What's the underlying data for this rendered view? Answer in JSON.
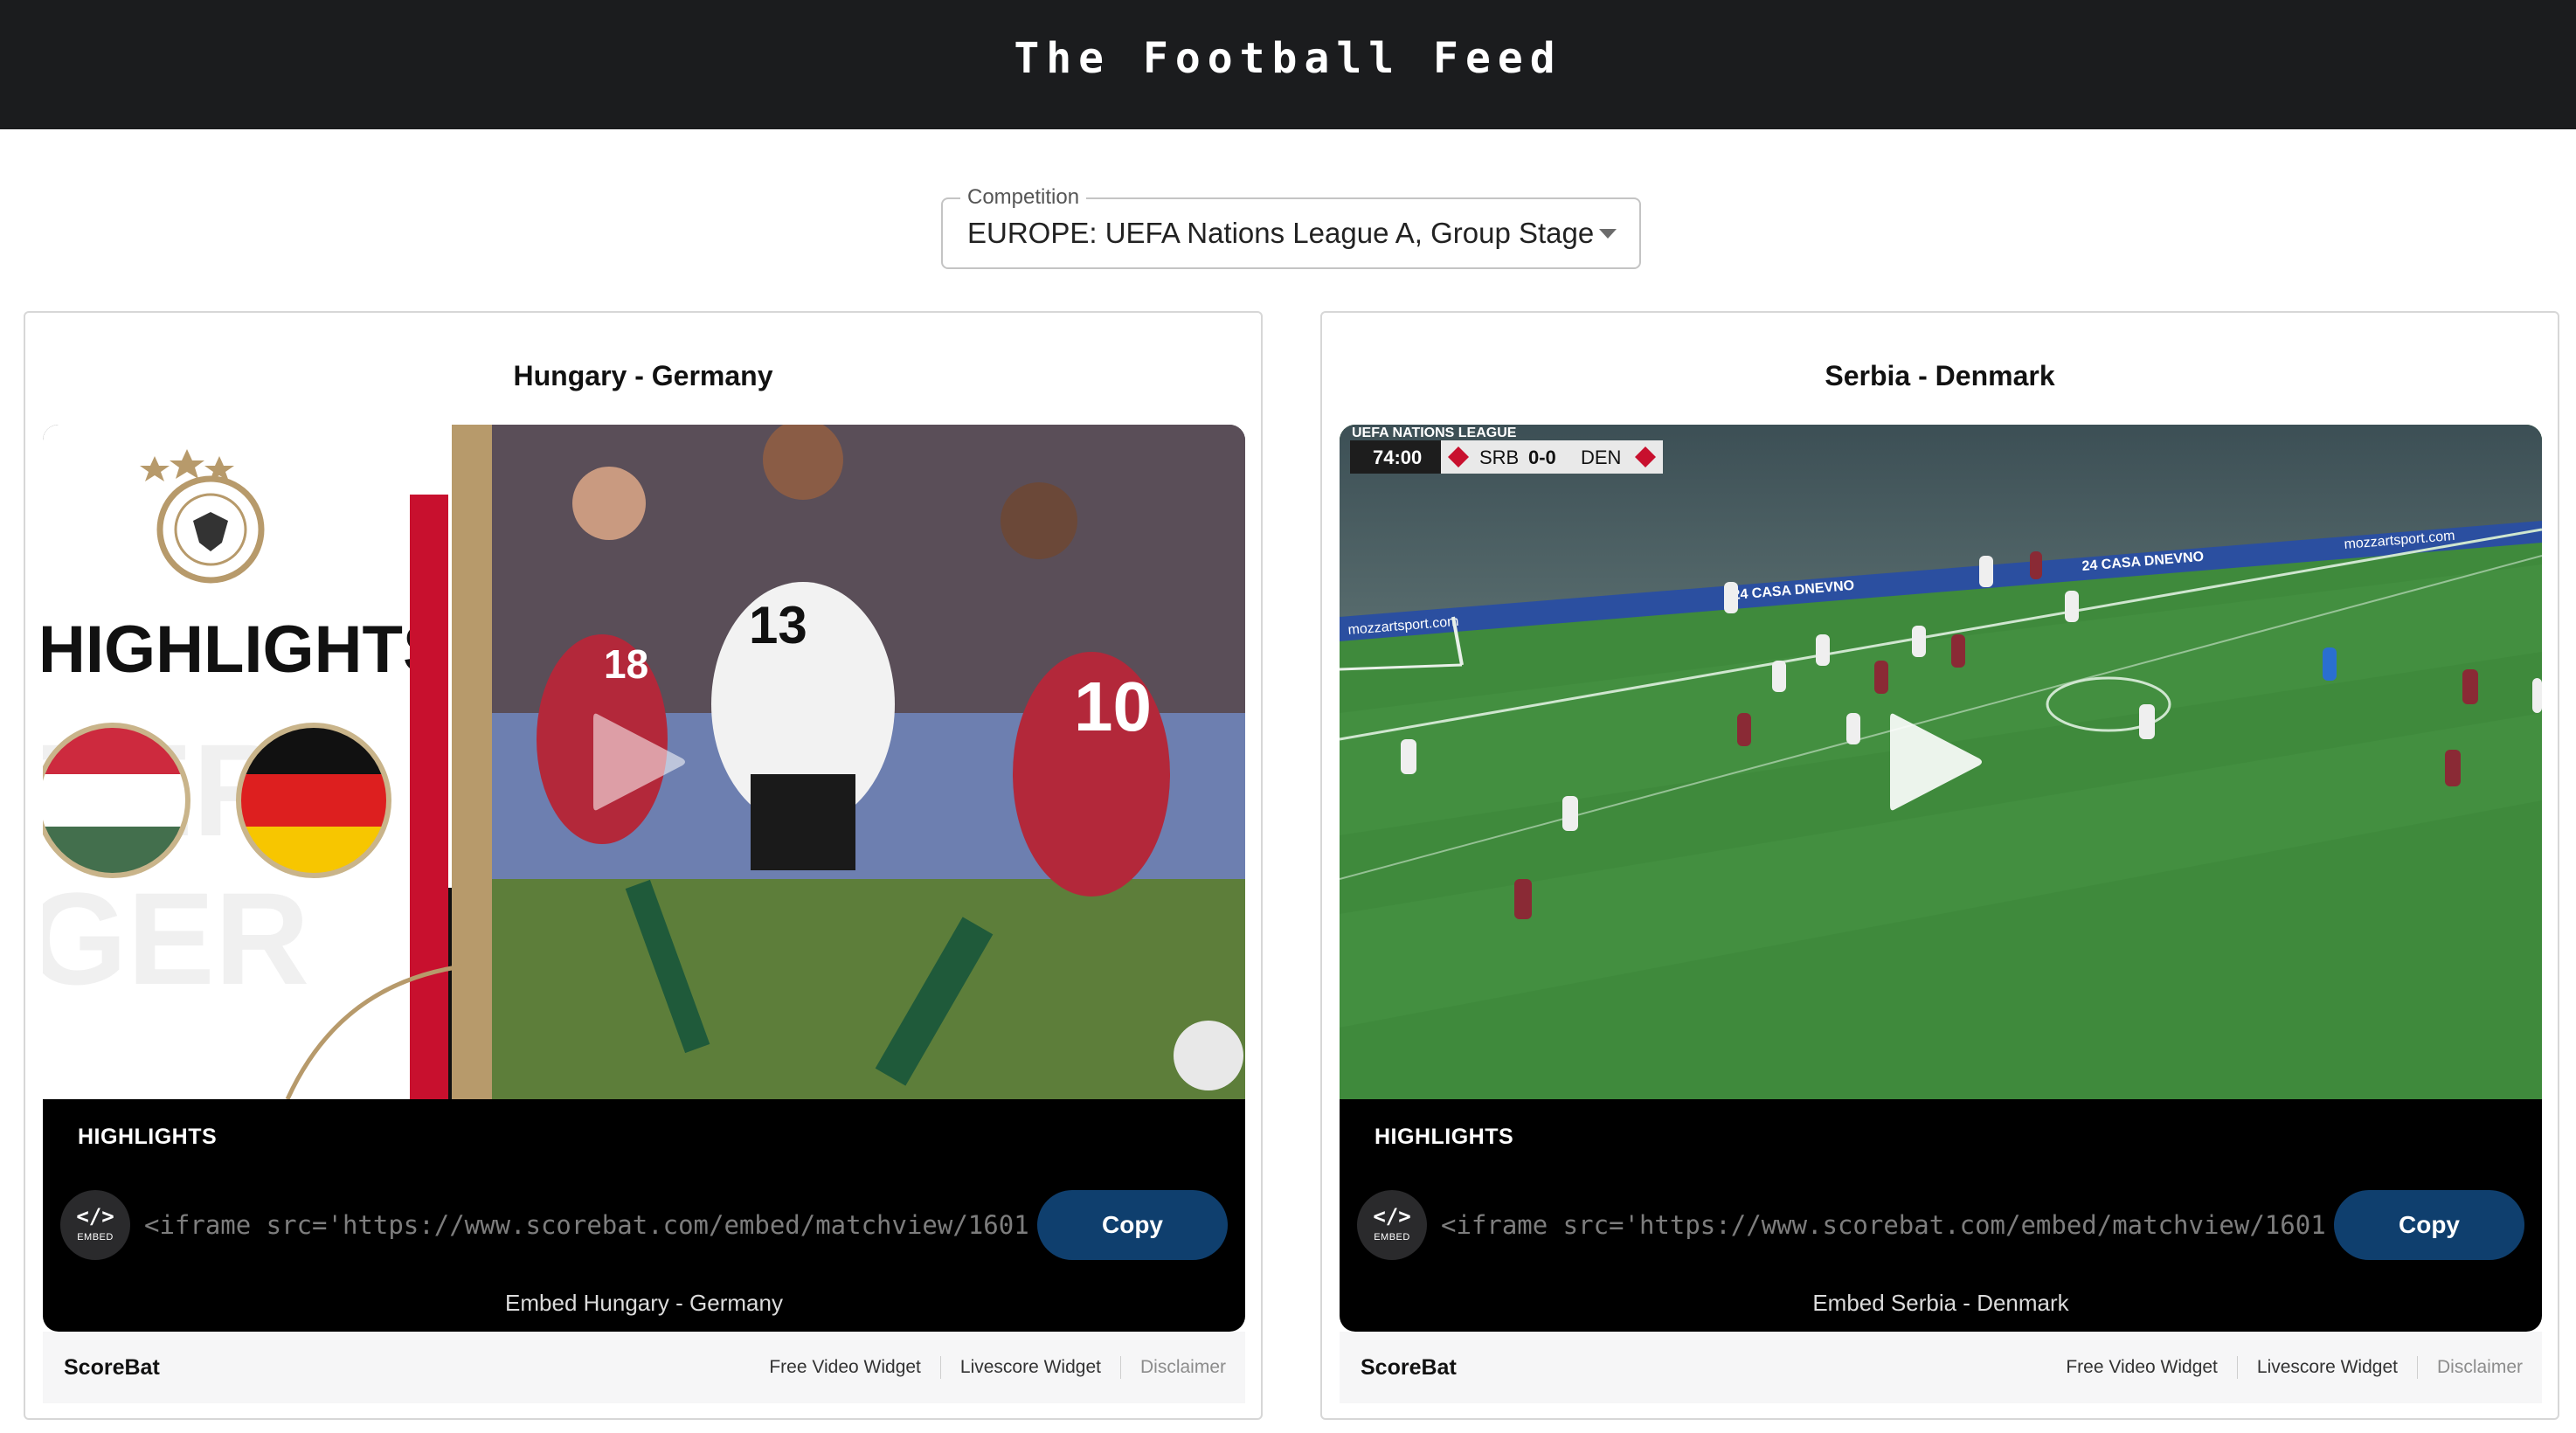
{
  "header": {
    "title": "The Football Feed"
  },
  "competition": {
    "label": "Competition",
    "selected": "EUROPE: UEFA Nations League A, Group Stage"
  },
  "matches": [
    {
      "title": "Hungary - Germany",
      "video_label": "HIGHLIGHTS",
      "thumbnail_text": "HIGHLIGHTS",
      "embed_icon_caption": "EMBED",
      "embed_code": "<iframe src='https://www.scorebat.com/embed/matchview/1601",
      "copy_label": "Copy",
      "embed_caption": "Embed Hungary - Germany"
    },
    {
      "title": "Serbia - Denmark",
      "video_label": "HIGHLIGHTS",
      "scoreboard": {
        "league": "UEFA NATIONS LEAGUE",
        "clock": "74:00",
        "home": "SRB",
        "score": "0-0",
        "away": "DEN"
      },
      "ad_boards": [
        "24 CASA DNEVNO",
        "mozzartsport.com"
      ],
      "embed_icon_caption": "EMBED",
      "embed_code": "<iframe src='https://www.scorebat.com/embed/matchview/1601",
      "copy_label": "Copy",
      "embed_caption": "Embed Serbia - Denmark"
    }
  ],
  "footer": {
    "brand": "ScoreBat",
    "links": [
      "Free Video Widget",
      "Livescore Widget",
      "Disclaimer"
    ]
  },
  "colors": {
    "topbar": "#1b1c1e",
    "copy_button": "#0f3f6e",
    "pitch": "#3f8a3c"
  },
  "icons": {
    "play": "play-icon",
    "embed": "code-icon",
    "caret": "chevron-down-icon"
  }
}
